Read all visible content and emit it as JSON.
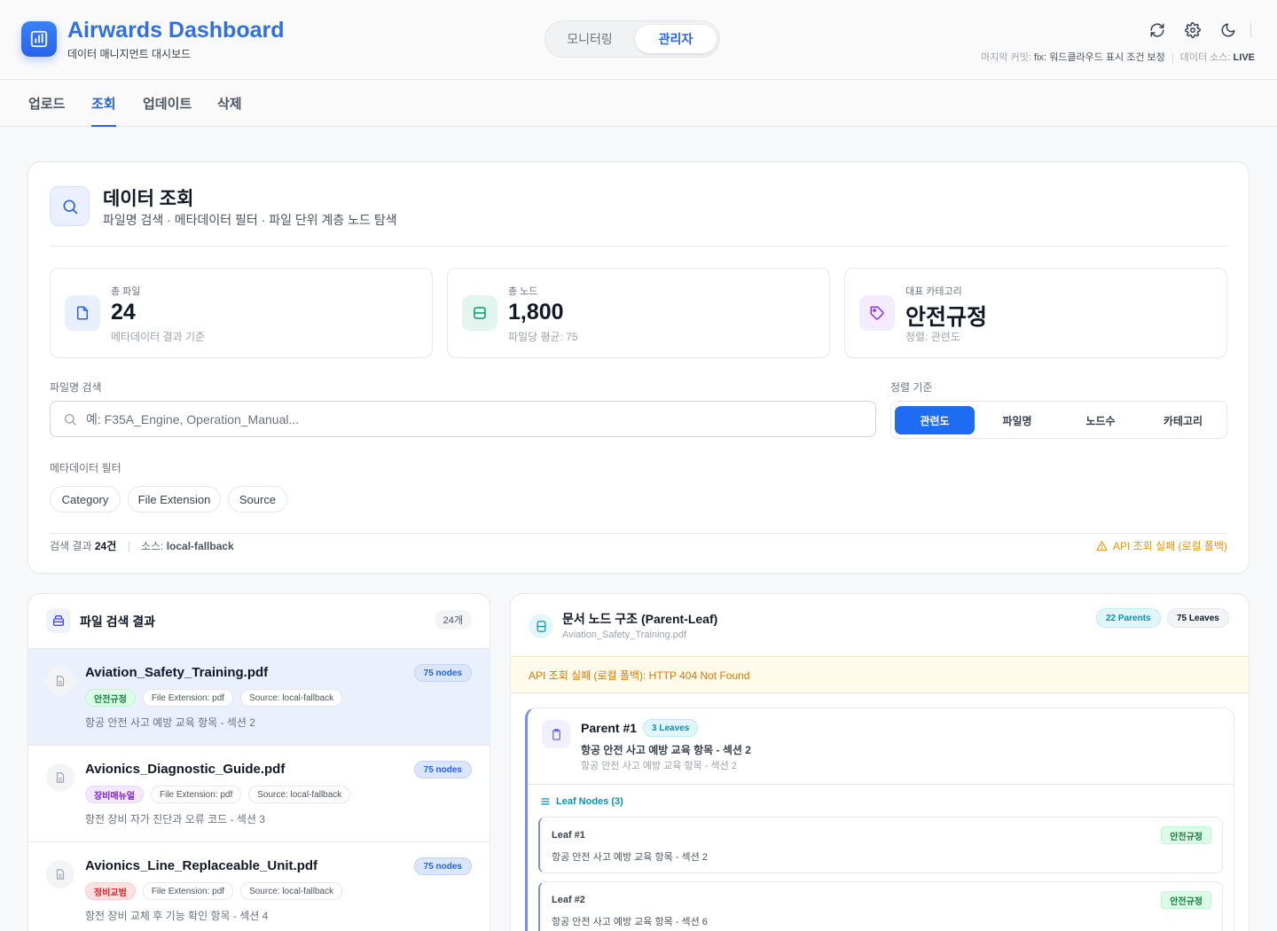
{
  "header": {
    "title": "Airwards Dashboard",
    "subtitle": "데이터 매니지먼트 대시보드",
    "modes": [
      {
        "label": "모니터링"
      },
      {
        "label": "관리자"
      }
    ],
    "meta": {
      "commit_label": "마지막 커밋:",
      "commit_value": "fix: 워드클라우드 표시 조건 보정",
      "source_label": "데이터 소스:",
      "source_value": "LIVE"
    }
  },
  "nav": {
    "tabs": [
      {
        "label": "업로드"
      },
      {
        "label": "조회"
      },
      {
        "label": "업데이트"
      },
      {
        "label": "삭제"
      }
    ]
  },
  "main": {
    "title": "데이터 조회",
    "subtitle": "파일명 검색 · 메타데이터 필터 · 파일 단위 계층 노드 탐색",
    "stats": [
      {
        "label": "총 파일",
        "value": "24",
        "note": "메타데이터 결과 기준"
      },
      {
        "label": "총 노드",
        "value": "1,800",
        "note": "파일당 평균: 75"
      },
      {
        "label": "대표 카테고리",
        "value": "안전규정",
        "note": "정렬: 관련도"
      }
    ],
    "search": {
      "label": "파일명 검색",
      "placeholder": "예: F35A_Engine, Operation_Manual..."
    },
    "sort": {
      "label": "정렬 기준",
      "options": [
        {
          "label": "관련도"
        },
        {
          "label": "파일명"
        },
        {
          "label": "노드수"
        },
        {
          "label": "카테고리"
        }
      ]
    },
    "filters": {
      "label": "메타데이터 필터",
      "chips": [
        {
          "label": "Category"
        },
        {
          "label": "File Extension"
        },
        {
          "label": "Source"
        }
      ]
    },
    "result": {
      "prefix": "검색 결과",
      "count": "24건",
      "source_label": "소스:",
      "source_value": "local-fallback",
      "warning": "API 조회 실패 (로컬 폴백)"
    }
  },
  "file_list": {
    "title": "파일 검색 결과",
    "count": "24개",
    "items": [
      {
        "name": "Aviation_Safety_Training.pdf",
        "nodes": "75 nodes",
        "category": "안전규정",
        "ext": "File Extension: pdf",
        "source": "Source: local-fallback",
        "desc": "항공 안전 사고 예방 교육 항목 - 섹션 2"
      },
      {
        "name": "Avionics_Diagnostic_Guide.pdf",
        "nodes": "75 nodes",
        "category": "장비매뉴얼",
        "ext": "File Extension: pdf",
        "source": "Source: local-fallback",
        "desc": "항전 장비 자가 진단과 오류 코드 - 섹션 3"
      },
      {
        "name": "Avionics_Line_Replaceable_Unit.pdf",
        "nodes": "75 nodes",
        "category": "정비교범",
        "ext": "File Extension: pdf",
        "source": "Source: local-fallback",
        "desc": "항전 장비 교체 후 기능 확인 항목 - 섹션 4"
      }
    ]
  },
  "tree": {
    "title": "문서 노드 구조 (Parent-Leaf)",
    "file": "Aviation_Safety_Training.pdf",
    "parents_badge": "22 Parents",
    "leaves_badge": "75 Leaves",
    "error": "API 조회 실패 (로컬 폴백): HTTP 404 Not Found",
    "parent": {
      "title": "Parent #1",
      "badge": "3 Leaves",
      "heading": "항공 안전 사고 예방 교육 항목 - 섹션 2",
      "sub": "항공 안전 사고 예방 교육 항목 - 섹션 2"
    },
    "leaf_header": "Leaf Nodes (3)",
    "leaves": [
      {
        "title": "Leaf #1",
        "text": "항공 안전 사고 예방 교육 항목 - 섹션 2",
        "tag": "안전규정"
      },
      {
        "title": "Leaf #2",
        "text": "항공 안전 사고 예방 교육 항목 - 섹션 6",
        "tag": "안전규정"
      }
    ]
  }
}
